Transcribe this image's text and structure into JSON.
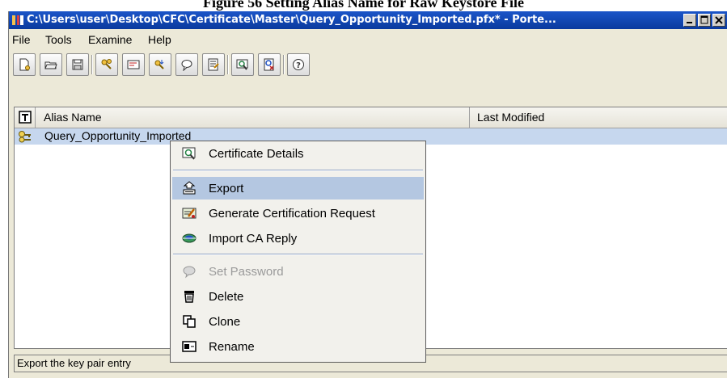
{
  "caption": "Figure 56 Setting Alias Name for Raw Keystore File",
  "window": {
    "title": "C:\\Users\\user\\Desktop\\CFC\\Certificate\\Master\\Query_Opportunity_Imported.pfx* - Porte...",
    "title_icon": "portecle-app-icon",
    "controls": [
      "minimize-icon",
      "maximize-icon",
      "close-icon"
    ]
  },
  "menubar": [
    {
      "label": "File",
      "mnemonic": "F"
    },
    {
      "label": "Tools",
      "mnemonic": "T"
    },
    {
      "label": "Examine",
      "mnemonic": "E"
    },
    {
      "label": "Help",
      "mnemonic": "H"
    }
  ],
  "toolbar": {
    "buttons": [
      "new-keystore-icon",
      "open-keystore-icon",
      "save-keystore-icon",
      "generate-key-pair-icon",
      "import-trusted-cert-icon",
      "import-key-pair-icon",
      "set-keystore-password-icon",
      "keystore-report-icon",
      "examine-certificate-icon",
      "examine-crl-icon",
      "help-icon"
    ]
  },
  "table": {
    "columns": [
      "Alias Name",
      "Last Modified"
    ],
    "type_column_icon": "type-column-icon",
    "rows": [
      {
        "icon": "key-pair-icon",
        "alias": "Query_Opportunity_Imported",
        "last_modified": ""
      }
    ]
  },
  "context_menu": {
    "items": [
      {
        "label": "Certificate Details",
        "mnemonic": "C",
        "icon": "certificate-details-icon",
        "state": "normal"
      },
      {
        "separator": true
      },
      {
        "label": "Export",
        "mnemonic": "E",
        "icon": "export-icon",
        "state": "highlighted"
      },
      {
        "label": "Generate Certification Request",
        "mnemonic": "G",
        "icon": "generate-csr-icon",
        "state": "normal"
      },
      {
        "label": "Import CA Reply",
        "mnemonic": "I",
        "icon": "import-ca-reply-icon",
        "state": "normal"
      },
      {
        "separator": true
      },
      {
        "label": "Set Password",
        "mnemonic": "S",
        "icon": "set-password-icon",
        "state": "disabled"
      },
      {
        "label": "Delete",
        "mnemonic": "D",
        "icon": "delete-icon",
        "state": "normal"
      },
      {
        "label": "Clone",
        "mnemonic": "l",
        "icon": "clone-icon",
        "state": "normal"
      },
      {
        "label": "Rename",
        "mnemonic": "R",
        "icon": "rename-icon",
        "state": "normal"
      }
    ]
  },
  "status_bar": {
    "text": "Export the key pair entry"
  },
  "colors": {
    "title_bar": "#0a3a9e",
    "selection": "#c6d7ee",
    "menu_highlight": "#b4c7e1",
    "window_bg": "#ece9d8"
  }
}
